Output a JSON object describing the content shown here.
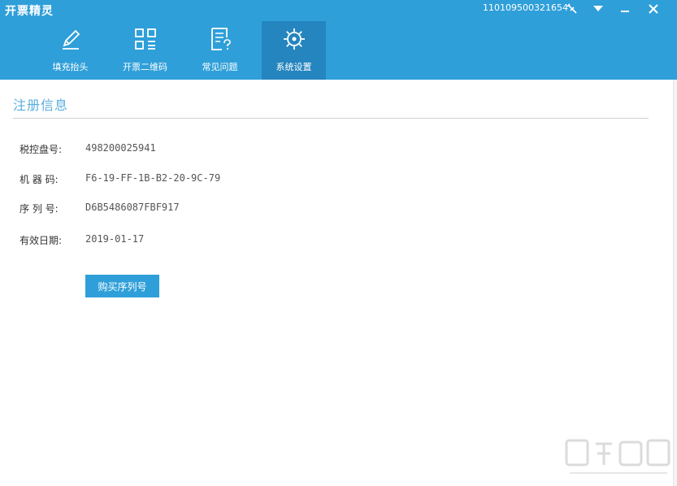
{
  "app": {
    "title": "开票精灵",
    "account_id": "110109500321654"
  },
  "colors": {
    "accent": "#2f9fd9",
    "active_tab": "#2585be",
    "section_title": "#5aaedf"
  },
  "window_controls": [
    "pin-icon",
    "dropdown-icon",
    "minimize-icon",
    "close-icon"
  ],
  "nav": [
    {
      "label": "填充抬头",
      "icon": "pencil-icon",
      "active": false
    },
    {
      "label": "开票二维码",
      "icon": "qrcode-icon",
      "active": false
    },
    {
      "label": "常见问题",
      "icon": "faq-icon",
      "active": false
    },
    {
      "label": "系统设置",
      "icon": "gear-icon",
      "active": true
    }
  ],
  "registration": {
    "title": "注册信息",
    "fields": [
      {
        "label": "税控盘号:",
        "value": "498200025941"
      },
      {
        "label": "机 器 码:",
        "value": "F6-19-FF-1B-B2-20-9C-79"
      },
      {
        "label": "序 列 号:",
        "value": "D6B5486087FBF917"
      },
      {
        "label": "有效日期:",
        "value": "2019-01-17"
      }
    ],
    "buy_button": "购买序列号"
  }
}
